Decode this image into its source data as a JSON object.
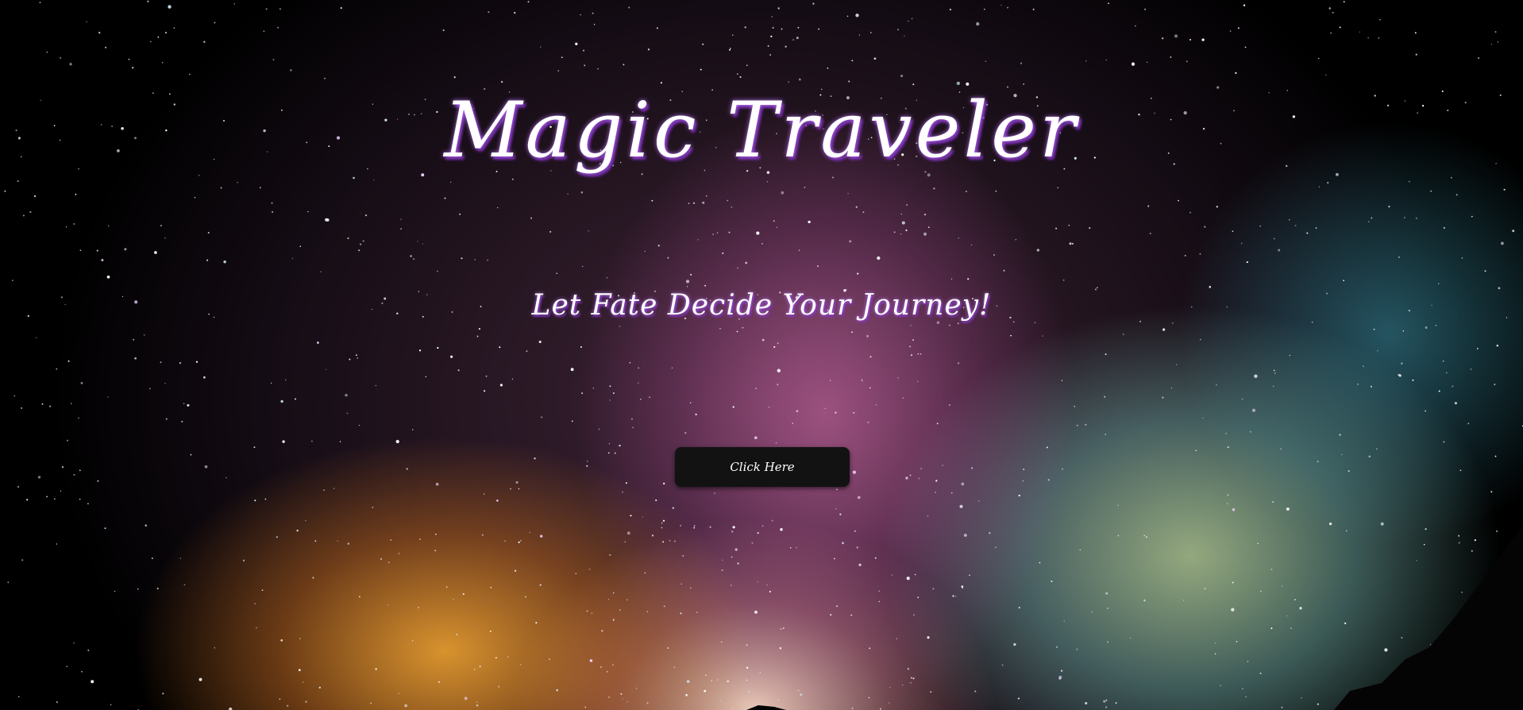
{
  "hero": {
    "title": "Magic Traveler",
    "subtitle": "Let Fate Decide Your Journey!",
    "button_label": "Click Here"
  },
  "colors": {
    "button_bg": "#121212",
    "text": "#ffffff",
    "text_glow": "#8a3cc8"
  },
  "background": {
    "scene": "starry-night-sky-milky-way"
  }
}
